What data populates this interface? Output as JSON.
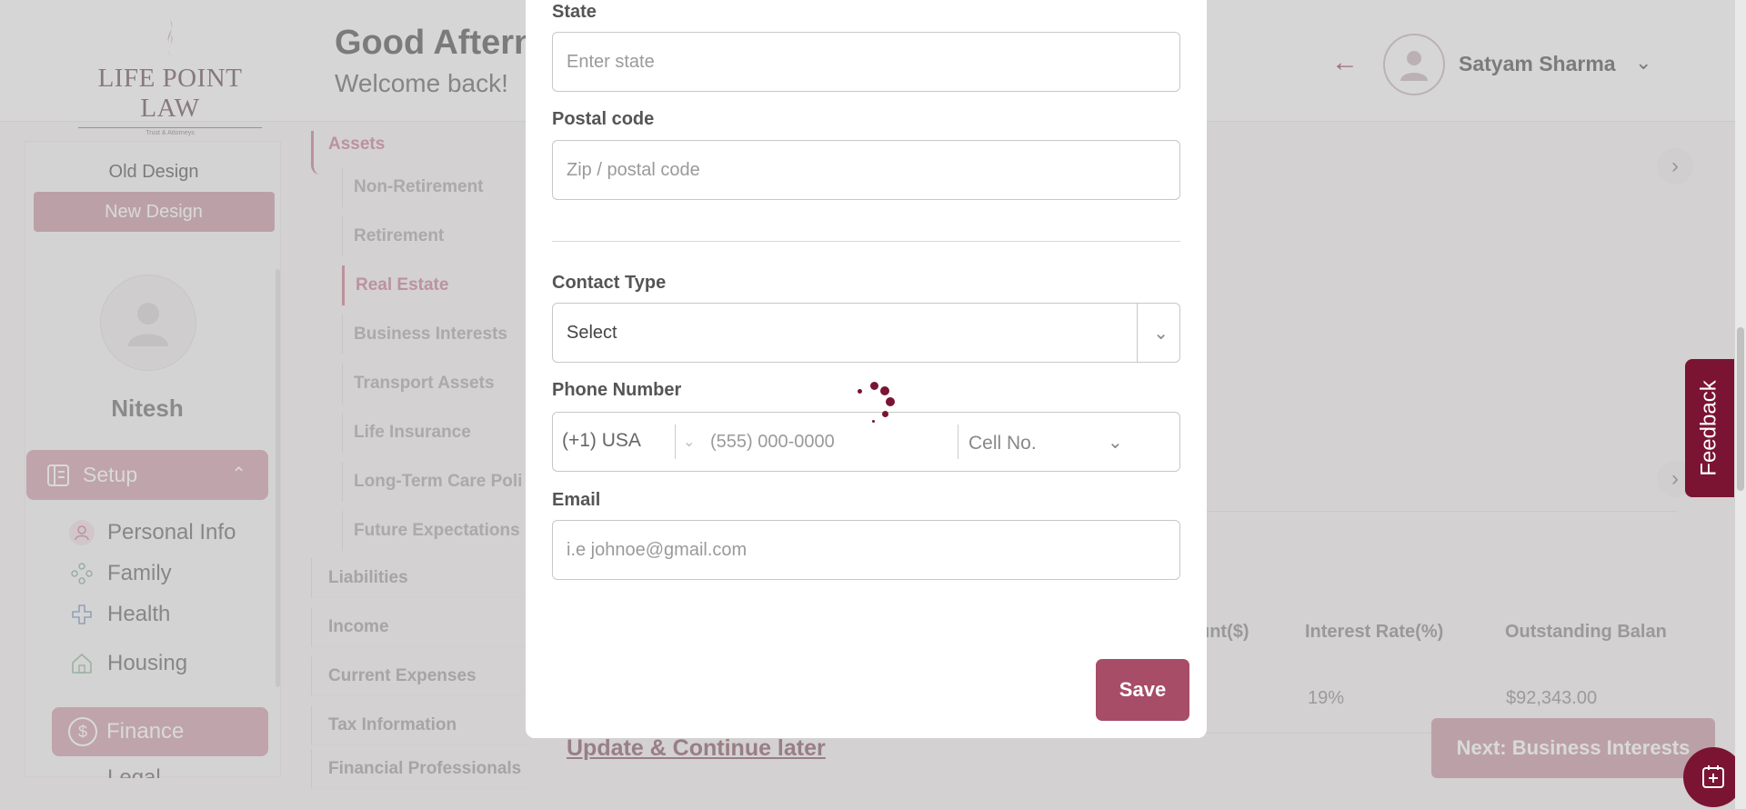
{
  "header": {
    "logo_text": "LIFE POINT LAW",
    "logo_tagline": "Trust & Attorneys",
    "greeting": "Good Aftern",
    "welcome": "Welcome back!",
    "user_name": "Satyam Sharma"
  },
  "sidebar": {
    "old_design": "Old Design",
    "new_design": "New Design",
    "profile_name": "Nitesh",
    "setup_label": "Setup",
    "items": [
      {
        "label": "Personal Info"
      },
      {
        "label": "Family"
      },
      {
        "label": "Health"
      },
      {
        "label": "Housing"
      }
    ],
    "finance_label": "Finance",
    "legal_label": "Legal"
  },
  "subnav": {
    "assets": "Assets",
    "asset_items": [
      "Non-Retirement",
      "Retirement",
      "Real Estate",
      "Business Interests",
      "Transport Assets",
      "Life Insurance",
      "Long-Term Care Poli",
      "Future Expectations"
    ],
    "groups": [
      "Liabilities",
      "Income",
      "Current Expenses",
      "Tax Information",
      "Financial Professionals"
    ]
  },
  "table": {
    "headers": [
      "unt($)",
      "Interest Rate(%)",
      "Outstanding Balan"
    ],
    "row": [
      "19%",
      "$92,343.00"
    ]
  },
  "footer": {
    "update_link": "Update & Continue later",
    "next_button": "Next: Business Interests"
  },
  "feedback_label": "Feedback",
  "modal": {
    "state_label": "State",
    "state_placeholder": "Enter state",
    "postal_label": "Postal code",
    "postal_placeholder": "Zip / postal code",
    "contact_type_label": "Contact Type",
    "contact_type_value": "Select",
    "phone_label": "Phone Number",
    "phone_country": "(+1) USA",
    "phone_placeholder": "(555) 000-0000",
    "phone_type": "Cell No.",
    "email_label": "Email",
    "email_placeholder": "i.e johnoe@gmail.com",
    "save_label": "Save"
  },
  "colors": {
    "brand": "#7a1432",
    "accent_muted": "#c99aa5",
    "save_button": "#a74d67"
  }
}
